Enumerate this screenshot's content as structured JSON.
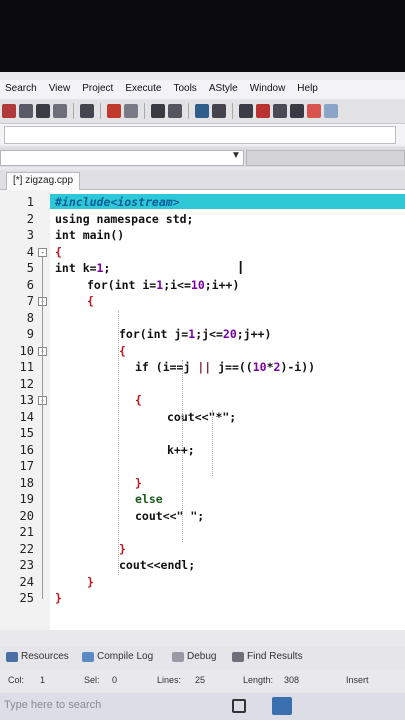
{
  "menu": [
    "Search",
    "View",
    "Project",
    "Execute",
    "Tools",
    "AStyle",
    "Window",
    "Help"
  ],
  "tab": {
    "label": "[*] zigzag.cpp"
  },
  "lines": [
    {
      "n": "1",
      "text": "#include<iostream>"
    },
    {
      "n": "2",
      "text": "using namespace std;"
    },
    {
      "n": "3",
      "text": "int main()"
    },
    {
      "n": "4",
      "text": "{"
    },
    {
      "n": "5",
      "text": "int k=1;"
    },
    {
      "n": "6",
      "text": "    for(int i=1;i<=10;i++)"
    },
    {
      "n": "7",
      "text": "    {"
    },
    {
      "n": "8",
      "text": ""
    },
    {
      "n": "9",
      "text": "        for(int j=1;j<=20;j++)"
    },
    {
      "n": "10",
      "text": "        {"
    },
    {
      "n": "11",
      "text": "          if (i==j || j==((10*2)-i))"
    },
    {
      "n": "12",
      "text": ""
    },
    {
      "n": "13",
      "text": "          {"
    },
    {
      "n": "14",
      "text": "              cout<<\"*\";"
    },
    {
      "n": "15",
      "text": ""
    },
    {
      "n": "16",
      "text": "              k++;"
    },
    {
      "n": "17",
      "text": ""
    },
    {
      "n": "18",
      "text": "          }"
    },
    {
      "n": "19",
      "text": "          else"
    },
    {
      "n": "20",
      "text": "          cout<<\" \";"
    },
    {
      "n": "21",
      "text": ""
    },
    {
      "n": "22",
      "text": "        }"
    },
    {
      "n": "23",
      "text": "        cout<<endl;"
    },
    {
      "n": "24",
      "text": "    }"
    },
    {
      "n": "25",
      "text": "}"
    }
  ],
  "bottom_tabs": [
    "Resources",
    "Compile Log",
    "Debug",
    "Find Results"
  ],
  "status": {
    "col_label": "Col:",
    "col": "1",
    "sel_label": "Sel:",
    "sel": "0",
    "lines_label": "Lines:",
    "lines": "25",
    "length_label": "Length:",
    "length": "308",
    "mode": "Insert"
  },
  "taskbar": {
    "search_placeholder": "Type here to search"
  },
  "colors": {
    "current_line": "#2ec8d6",
    "brace": "#c0141f",
    "number": "#7a00a0"
  }
}
